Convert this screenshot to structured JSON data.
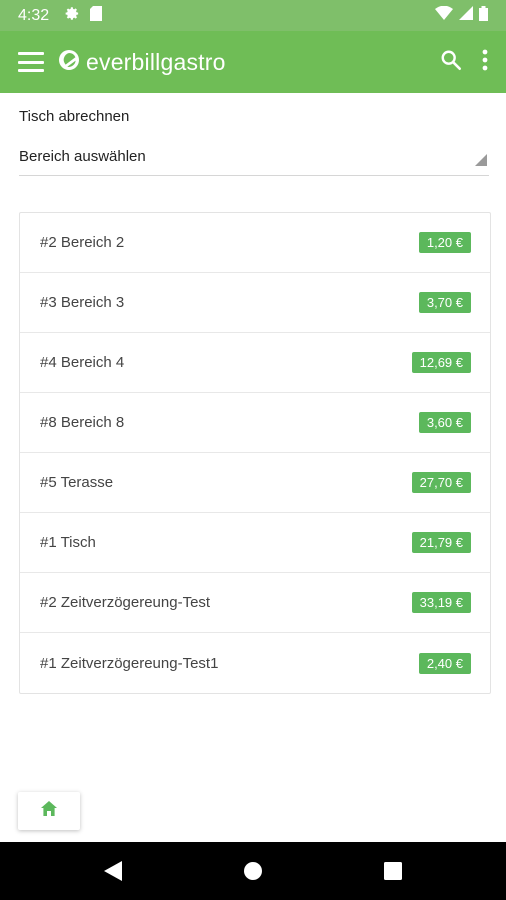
{
  "status_bar": {
    "time": "4:32",
    "icons": [
      "gear-icon",
      "sd-card-icon",
      "wifi-icon",
      "signal-icon",
      "battery-icon"
    ]
  },
  "app_bar": {
    "logo_text": "everbillgastro",
    "icons": [
      "menu-icon",
      "search-icon",
      "more-vert-icon"
    ]
  },
  "page": {
    "heading": "Tisch abrechnen",
    "area_select": {
      "value": "Bereich auswählen"
    }
  },
  "tables": [
    {
      "name": "#2 Bereich 2",
      "amount": "1,20 €"
    },
    {
      "name": "#3 Bereich 3",
      "amount": "3,70 €"
    },
    {
      "name": "#4 Bereich 4",
      "amount": "12,69 €"
    },
    {
      "name": "#8 Bereich 8",
      "amount": "3,60 €"
    },
    {
      "name": "#5 Terasse",
      "amount": "27,70 €"
    },
    {
      "name": "#1 Tisch",
      "amount": "21,79 €"
    },
    {
      "name": "#2 Zeitverzögereung-Test",
      "amount": "33,19 €"
    },
    {
      "name": "#1 Zeitverzögereung-Test1",
      "amount": "2,40 €"
    }
  ],
  "colors": {
    "app_bar": "#6fbd56",
    "status_bar": "#7fbf6a",
    "badge": "#5cb85c",
    "home_icon": "#5cb85c"
  }
}
